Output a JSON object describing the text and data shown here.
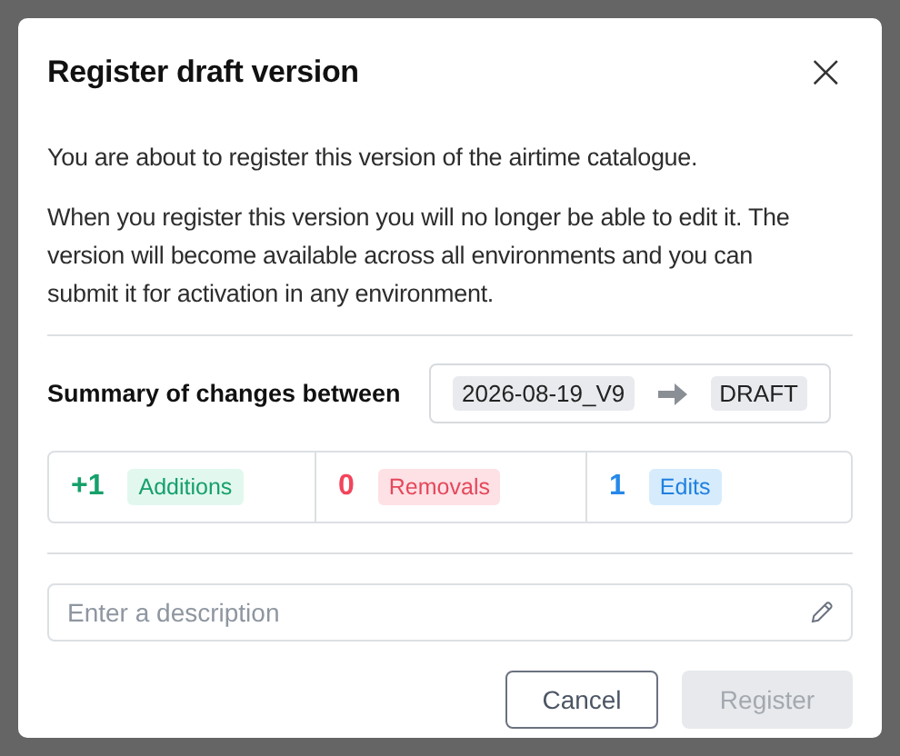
{
  "dialog": {
    "title": "Register draft version",
    "close_label": "×",
    "paragraphs": [
      "You are about to register this version of the airtime catalogue.",
      "When you register this version you will no longer be able to edit it. The version will become available across all environments and you can submit it for activation in any environment."
    ],
    "summary": {
      "label": "Summary of changes between",
      "from": "2026-08-19_V9",
      "to": "DRAFT"
    },
    "stats": [
      {
        "kind": "additions",
        "value": "+1",
        "label": "Additions"
      },
      {
        "kind": "removals",
        "value": "0",
        "label": "Removals"
      },
      {
        "kind": "edits",
        "value": "1",
        "label": "Edits"
      }
    ],
    "description": {
      "placeholder": "Enter a description"
    },
    "buttons": [
      {
        "label": "Cancel",
        "kind": "secondary",
        "disabled": false
      },
      {
        "label": "Register",
        "kind": "primary",
        "disabled": true
      }
    ]
  }
}
